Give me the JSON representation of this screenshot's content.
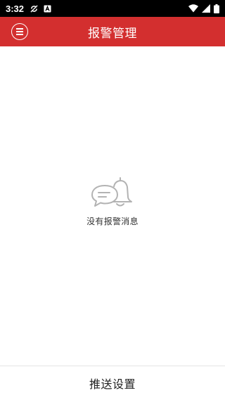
{
  "status_bar": {
    "time": "3:32",
    "icons": [
      "sync-off-icon",
      "a-notification-icon",
      "wifi-icon",
      "signal-icon",
      "battery-icon"
    ]
  },
  "header": {
    "title": "报警管理",
    "menu_icon": "menu-icon",
    "background": "#d32f2f"
  },
  "empty_state": {
    "icon": "chat-bell-icon",
    "message": "没有报警消息"
  },
  "bottom_bar": {
    "label": "推送设置"
  }
}
